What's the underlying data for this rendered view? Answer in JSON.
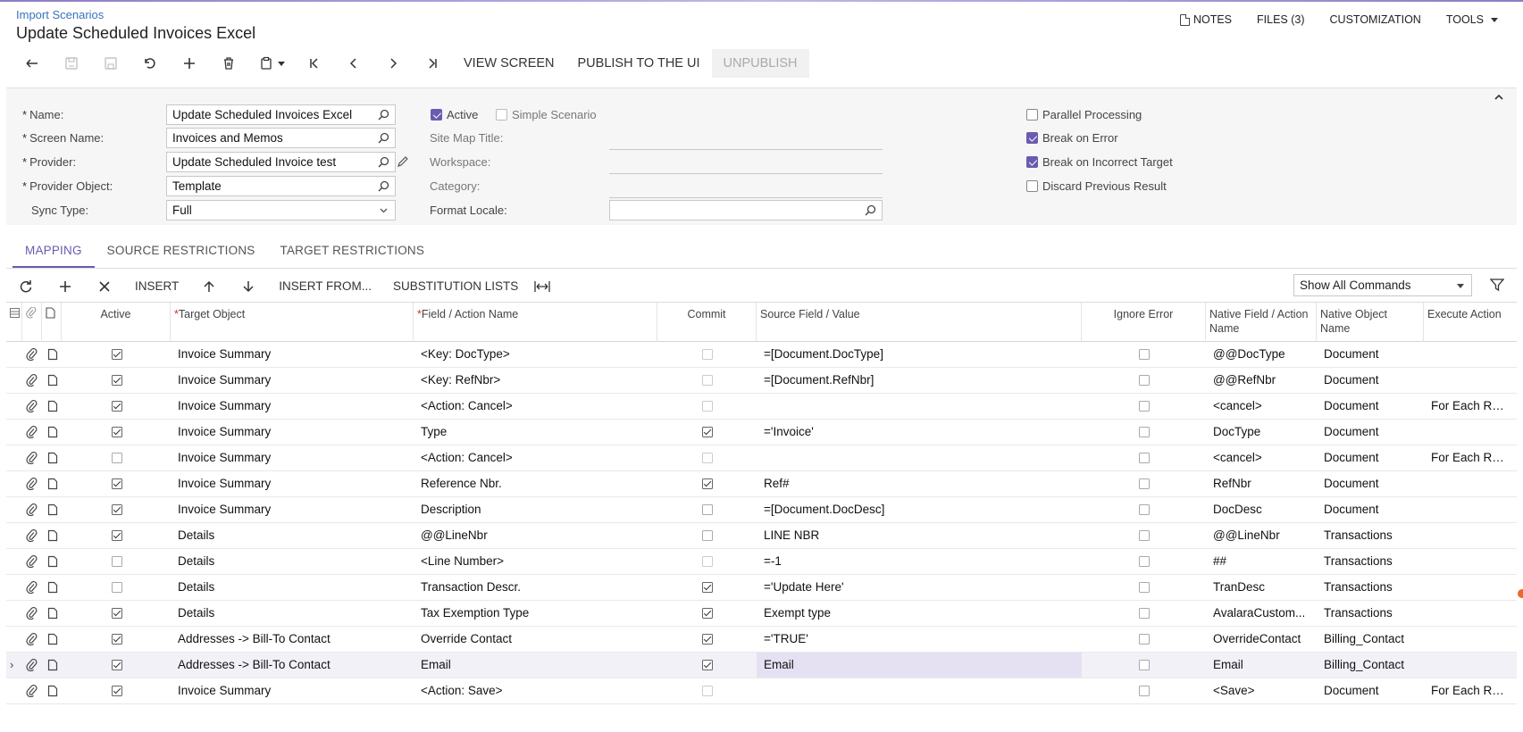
{
  "header": {
    "breadcrumb": "Import Scenarios",
    "title": "Update Scheduled Invoices Excel",
    "actions": {
      "notes": "NOTES",
      "files": "FILES (3)",
      "customization": "CUSTOMIZATION",
      "tools": "TOOLS"
    }
  },
  "toolbar": {
    "view_screen": "VIEW SCREEN",
    "publish": "PUBLISH TO THE UI",
    "unpublish": "UNPUBLISH"
  },
  "form": {
    "name_label": "Name:",
    "name_value": "Update Scheduled Invoices Excel",
    "screen_label": "Screen Name:",
    "screen_value": "Invoices and Memos",
    "provider_label": "Provider:",
    "provider_value": "Update Scheduled Invoice test",
    "provider_object_label": "Provider Object:",
    "provider_object_value": "Template",
    "sync_label": "Sync Type:",
    "sync_value": "Full",
    "active_label": "Active",
    "active": true,
    "simple_label": "Simple Scenario",
    "simple": false,
    "sitemap_label": "Site Map Title:",
    "workspace_label": "Workspace:",
    "category_label": "Category:",
    "locale_label": "Format Locale:",
    "locale_value": "",
    "parallel_label": "Parallel Processing",
    "parallel": false,
    "break_error_label": "Break on Error",
    "break_error": true,
    "break_target_label": "Break on Incorrect Target",
    "break_target": true,
    "discard_label": "Discard Previous Result",
    "discard": false
  },
  "tabs": [
    "MAPPING",
    "SOURCE RESTRICTIONS",
    "TARGET RESTRICTIONS"
  ],
  "grid_toolbar": {
    "insert": "INSERT",
    "insert_from": "INSERT FROM...",
    "substitution": "SUBSTITUTION LISTS",
    "command_filter": "Show All Commands"
  },
  "columns": {
    "active": "Active",
    "target": "Target Object",
    "field": "Field / Action Name",
    "commit": "Commit",
    "source": "Source Field / Value",
    "ignore": "Ignore Error",
    "native_field": "Native Field / Action Name",
    "native_object": "Native Object Name",
    "execute": "Execute Action"
  },
  "rows": [
    {
      "active": true,
      "target": "Invoice Summary",
      "field": "<Key: DocType>",
      "commit": false,
      "commit_dim": true,
      "source": "=[Document.DocType]",
      "ignore": false,
      "native_field": "@@DocType",
      "native_object": "Document",
      "execute": ""
    },
    {
      "active": true,
      "target": "Invoice Summary",
      "field": "<Key: RefNbr>",
      "commit": false,
      "commit_dim": true,
      "source": "=[Document.RefNbr]",
      "ignore": false,
      "native_field": "@@RefNbr",
      "native_object": "Document",
      "execute": ""
    },
    {
      "active": true,
      "target": "Invoice Summary",
      "field": "<Action: Cancel>",
      "commit": false,
      "commit_dim": true,
      "source": "",
      "ignore": false,
      "native_field": "<cancel>",
      "native_object": "Document",
      "execute": "For Each Rec..."
    },
    {
      "active": true,
      "target": "Invoice Summary",
      "field": "Type",
      "commit": true,
      "commit_dim": false,
      "source": "='Invoice'",
      "ignore": false,
      "native_field": "DocType",
      "native_object": "Document",
      "execute": ""
    },
    {
      "active": false,
      "target": "Invoice Summary",
      "field": "<Action: Cancel>",
      "commit": false,
      "commit_dim": true,
      "source": "",
      "ignore": false,
      "native_field": "<cancel>",
      "native_object": "Document",
      "execute": "For Each Rec..."
    },
    {
      "active": true,
      "target": "Invoice Summary",
      "field": "Reference Nbr.",
      "commit": true,
      "commit_dim": false,
      "source": "Ref#",
      "ignore": false,
      "native_field": "RefNbr",
      "native_object": "Document",
      "execute": ""
    },
    {
      "active": true,
      "target": "Invoice Summary",
      "field": "Description",
      "commit": false,
      "commit_dim": false,
      "source": "=[Document.DocDesc]",
      "ignore": false,
      "native_field": "DocDesc",
      "native_object": "Document",
      "execute": ""
    },
    {
      "active": true,
      "target": "Details",
      "field": "@@LineNbr",
      "commit": false,
      "commit_dim": false,
      "source": "LINE NBR",
      "ignore": false,
      "native_field": "@@LineNbr",
      "native_object": "Transactions",
      "execute": ""
    },
    {
      "active": false,
      "target": "Details",
      "field": "<Line Number>",
      "commit": false,
      "commit_dim": true,
      "source": "=-1",
      "ignore": false,
      "native_field": "##",
      "native_object": "Transactions",
      "execute": ""
    },
    {
      "active": false,
      "target": "Details",
      "field": "Transaction Descr.",
      "commit": true,
      "commit_dim": false,
      "source": "='Update Here'",
      "ignore": false,
      "native_field": "TranDesc",
      "native_object": "Transactions",
      "execute": ""
    },
    {
      "active": true,
      "target": "Details",
      "field": "Tax Exemption Type",
      "commit": true,
      "commit_dim": false,
      "source": "Exempt type",
      "ignore": false,
      "native_field": "AvalaraCustom...",
      "native_object": "Transactions",
      "execute": ""
    },
    {
      "active": true,
      "target": "Addresses -> Bill-To Contact",
      "field": "Override Contact",
      "commit": true,
      "commit_dim": false,
      "source": "='TRUE'",
      "ignore": false,
      "native_field": "OverrideContact",
      "native_object": "Billing_Contact",
      "execute": ""
    },
    {
      "active": true,
      "target": "Addresses -> Bill-To Contact",
      "field": "Email",
      "commit": true,
      "commit_dim": false,
      "source": "Email",
      "ignore": false,
      "native_field": "Email",
      "native_object": "Billing_Contact",
      "execute": "",
      "selected": true
    },
    {
      "active": true,
      "target": "Invoice Summary",
      "field": "<Action: Save>",
      "commit": false,
      "commit_dim": true,
      "source": "",
      "ignore": false,
      "native_field": "<Save>",
      "native_object": "Document",
      "execute": "For Each Rec..."
    }
  ]
}
